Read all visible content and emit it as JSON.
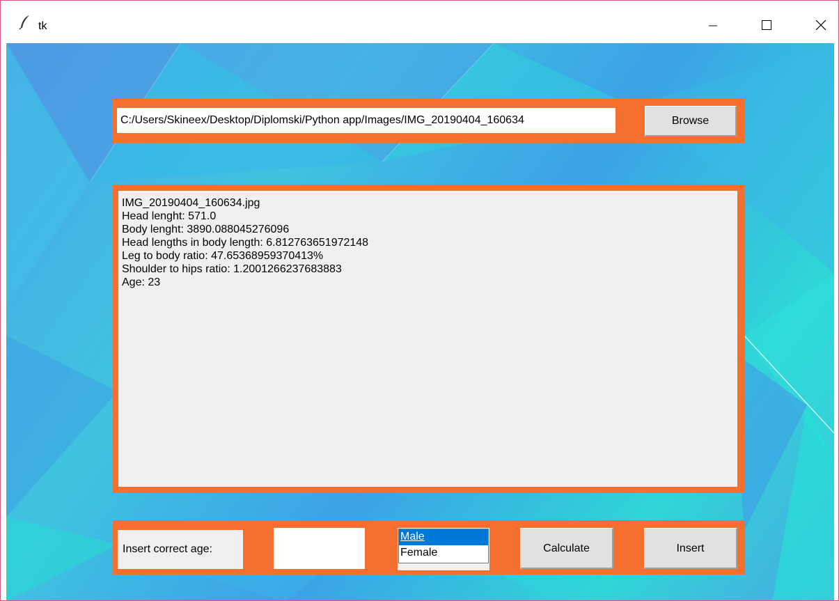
{
  "window": {
    "title": "tk",
    "controls": {
      "minimize_icon": "minimize-icon",
      "maximize_icon": "maximize-icon",
      "close_icon": "close-icon"
    },
    "app_icon": "feather-icon"
  },
  "file_selector": {
    "path_value": "C:/Users/Skineex/Desktop/Diplomski/Python app/Images/IMG_20190404_160634",
    "browse_label": "Browse"
  },
  "results": {
    "lines": [
      "IMG_20190404_160634.jpg",
      "Head lenght: 571.0",
      "Body lenght: 3890.088045276096",
      "Head lengths in body length: 6.812763651972148",
      "Leg to body ratio: 47.65368959370413%",
      "Shoulder to hips ratio: 1.2001266237683883",
      "Age: 23"
    ]
  },
  "bottom_bar": {
    "age_label": "Insert correct age:",
    "age_value": "",
    "gender_options": [
      "Male",
      "Female"
    ],
    "gender_selected": "Male",
    "calculate_label": "Calculate",
    "insert_label": "Insert"
  },
  "colors": {
    "frame_accent": "#f5702f",
    "selection": "#0078d7"
  }
}
